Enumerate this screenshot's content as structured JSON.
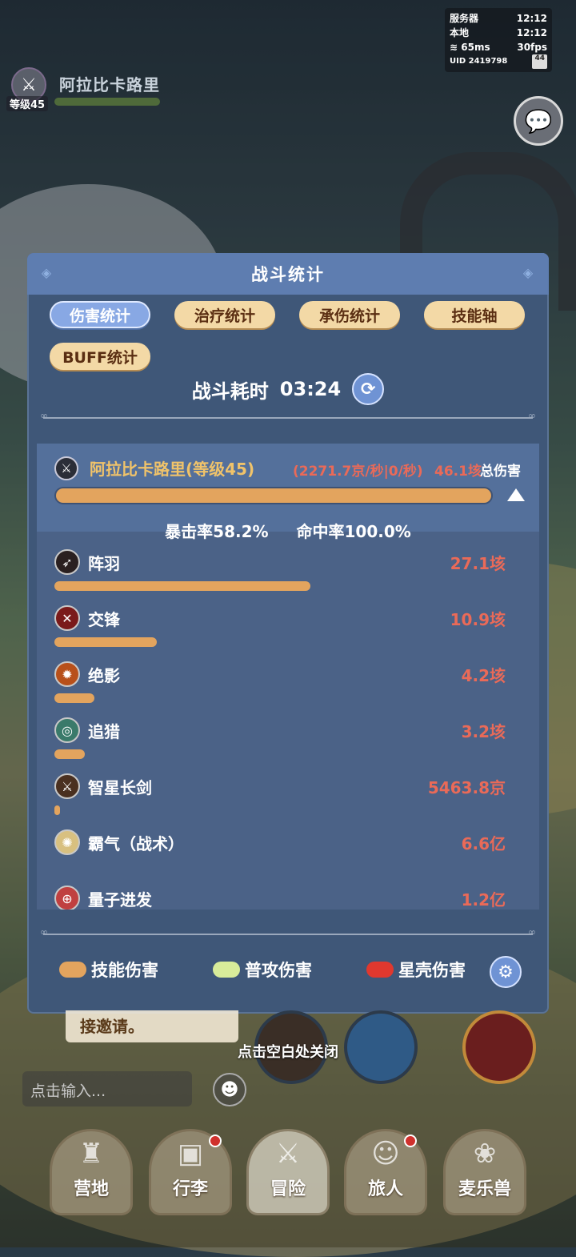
{
  "status": {
    "server_label": "服务器",
    "server_time": "12:12",
    "local_label": "本地",
    "local_time": "12:12",
    "ping": "65ms",
    "fps": "30fps",
    "uid": "UID 2419798",
    "battery": "44"
  },
  "player": {
    "name": "阿拉比卡路里",
    "level": "等级45"
  },
  "panel": {
    "title": "战斗统计",
    "tabs": [
      "伤害统计",
      "治疗统计",
      "承伤统计",
      "技能轴",
      "BUFF统计"
    ],
    "duration_label": "战斗耗时",
    "duration_value": "03:24",
    "hero": {
      "name": "阿拉比卡路里(等级45)",
      "dps": "(2271.7京/秒|0/秒)",
      "total": "46.1垓",
      "total_label": "总伤害",
      "crit": "暴击率58.2%",
      "hit": "命中率100.0%"
    },
    "skills": [
      {
        "name": "阵羽",
        "value": "27.1垓",
        "ratio": 0.588,
        "icon": "feather-icon",
        "color": "#2a2020"
      },
      {
        "name": "交锋",
        "value": "10.9垓",
        "ratio": 0.236,
        "icon": "crossed-swords-icon",
        "color": "#7a1a1a"
      },
      {
        "name": "绝影",
        "value": "4.2垓",
        "ratio": 0.091,
        "icon": "shadow-icon",
        "color": "#b8501a"
      },
      {
        "name": "追猎",
        "value": "3.2垓",
        "ratio": 0.069,
        "icon": "target-icon",
        "color": "#3a7a6a"
      },
      {
        "name": "智星长剑",
        "value": "5463.8京",
        "ratio": 0.012,
        "icon": "sword-icon",
        "color": "#4a3020"
      },
      {
        "name": "霸气（战术）",
        "value": "6.6亿",
        "ratio": 0,
        "icon": "burst-icon",
        "color": "#d8c080"
      },
      {
        "name": "量子进发",
        "value": "1.2亿",
        "ratio": 0,
        "icon": "quantum-icon",
        "color": "#c04040"
      }
    ],
    "legend": [
      {
        "label": "技能伤害",
        "color": "#e3a45e"
      },
      {
        "label": "普攻伤害",
        "color": "#d8ec9a"
      },
      {
        "label": "星壳伤害",
        "color": "#e0382e"
      }
    ]
  },
  "invite_text": "接邀请。",
  "close_hint": "点击空白处关闭",
  "chat_input": {
    "placeholder": "点击输入..."
  },
  "nav": [
    {
      "label": "营地",
      "icon": "castle-icon",
      "badge": false
    },
    {
      "label": "行李",
      "icon": "backpack-icon",
      "badge": true
    },
    {
      "label": "冒险",
      "icon": "crossed-swords-icon",
      "badge": false
    },
    {
      "label": "旅人",
      "icon": "traveler-icon",
      "badge": true
    },
    {
      "label": "麦乐兽",
      "icon": "pet-icon",
      "badge": false
    }
  ]
}
